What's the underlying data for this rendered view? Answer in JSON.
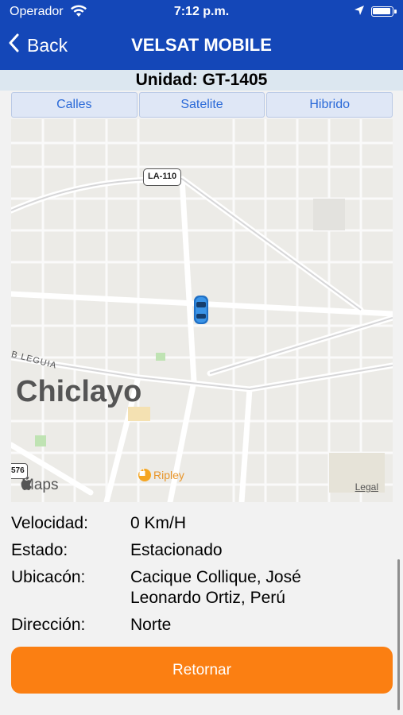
{
  "status_bar": {
    "carrier": "Operador",
    "time": "7:12 p.m.",
    "icons": [
      "wifi-icon",
      "location-arrow-icon",
      "battery-icon"
    ]
  },
  "nav": {
    "back_label": "Back",
    "title": "VELSAT MOBILE"
  },
  "unit": {
    "label": "Unidad: GT-1405"
  },
  "map_types": {
    "streets": "Calles",
    "satellite": "Satelite",
    "hybrid": "Hibrido"
  },
  "map": {
    "city_label": "Chiclayo",
    "highway_shield": "LA-110",
    "street_label": "B LEGUIA",
    "poi_label": "Ripley",
    "shield_partial": "576",
    "brand": "Maps",
    "legal": "Legal",
    "vehicle_icon": "car-icon"
  },
  "details": {
    "speed_label": "Velocidad:",
    "speed_value": "0 Km/H",
    "state_label": "Estado:",
    "state_value": "Estacionado",
    "location_label": "Ubicacón:",
    "location_value_line1": "Cacique Collique, José",
    "location_value_line2": "Leonardo Ortiz, Perú",
    "direction_label": "Dirección:",
    "direction_value": "Norte"
  },
  "actions": {
    "return_label": "Retornar"
  },
  "colors": {
    "nav_bg": "#1447b8",
    "accent_orange": "#fb7f12",
    "segment_text": "#2b6ad8",
    "unit_bar_bg": "#dce7f0"
  }
}
